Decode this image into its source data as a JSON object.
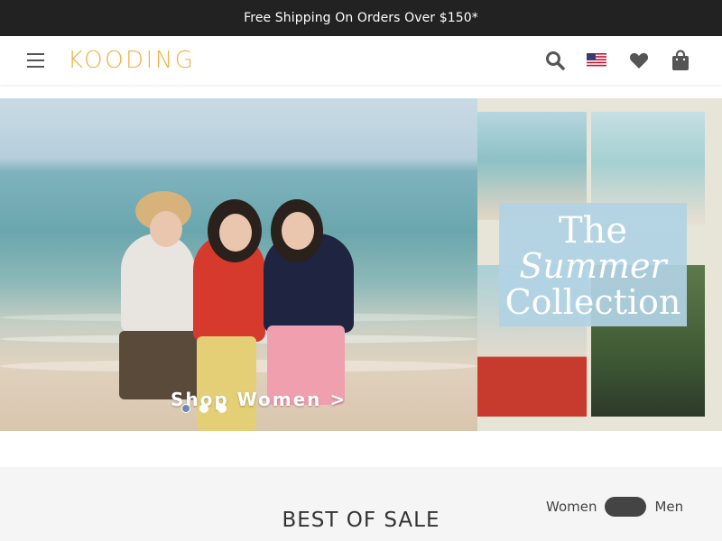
{
  "announcement": "Free Shipping On Orders Over $150*",
  "header": {
    "logo": "KOODING",
    "icons": [
      "menu-icon",
      "search-icon",
      "us-flag-icon",
      "heart-icon",
      "shopping-bag-icon"
    ]
  },
  "hero": {
    "left_cta": "Shop Women >",
    "right_title_line1": "The",
    "right_title_line2": "Summer",
    "right_title_line3": "Collection",
    "carousel_dots": 3,
    "active_dot": 2
  },
  "section": {
    "title": "BEST OF SALE",
    "toggle_left": "Women",
    "toggle_right": "Men"
  },
  "colors": {
    "announcement_bg": "#222222",
    "logo": "#f1b044",
    "toggle": "#444444"
  }
}
